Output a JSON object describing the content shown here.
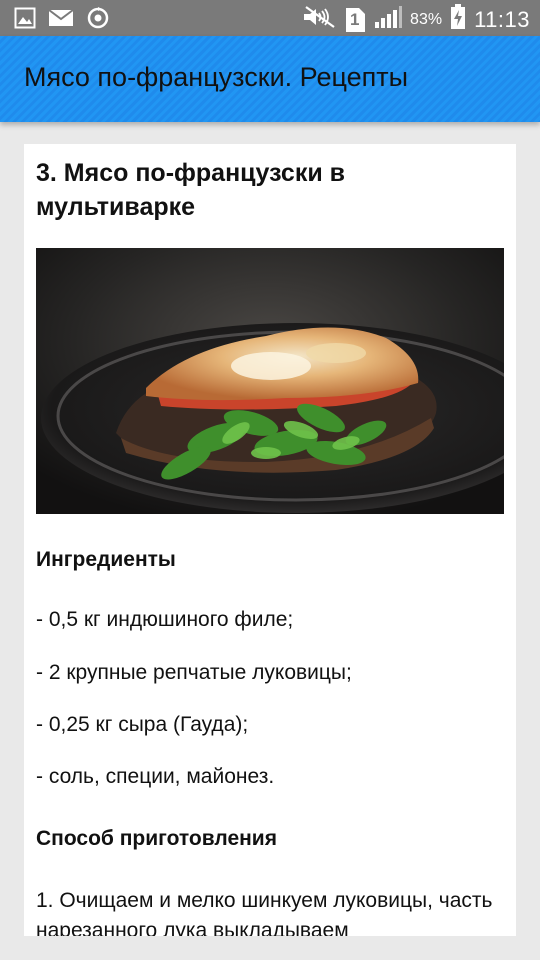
{
  "status_bar": {
    "battery_percent": "83%",
    "time": "11:13",
    "sim_slot": "1",
    "left_icons": [
      "image-icon",
      "mail-icon",
      "sync-icon"
    ],
    "right_icons": [
      "mute-icon",
      "sim-icon",
      "signal-icon",
      "battery-charging-icon"
    ]
  },
  "app_bar": {
    "title": "Мясо по-французски. Рецепты",
    "color": "#2196f3"
  },
  "recipe": {
    "title": "3. Мясо по-французски в мультиварке",
    "photo_icon": "dish-photo",
    "ingredients_heading": "Ингредиенты",
    "ingredients": [
      "- 0,5 кг индюшиного филе;",
      "- 2 крупные репчатые луковицы;",
      "- 0,25 кг сыра (Гауда);",
      "- соль, специи, майонез."
    ],
    "method_heading": "Способ приготовления",
    "method_text": "1. Очищаем и мелко шинкуем луковицы, часть нарезанного лука выкладываем"
  }
}
